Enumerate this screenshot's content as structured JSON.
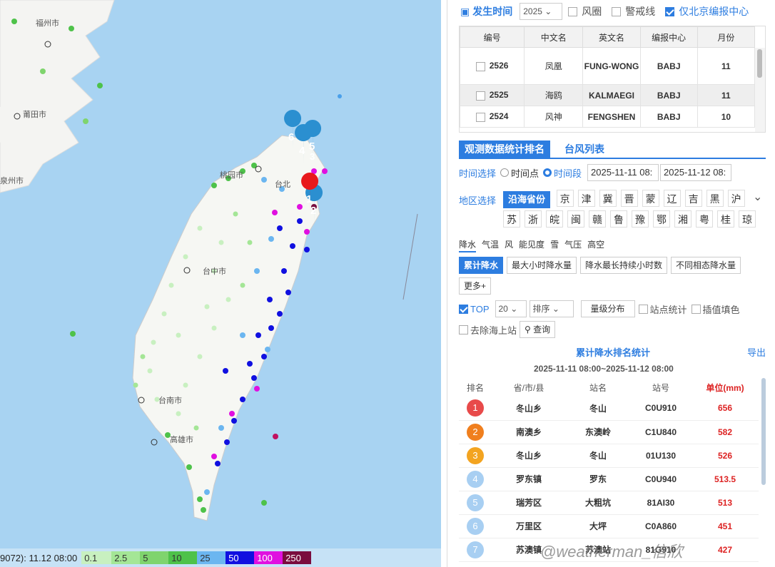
{
  "map": {
    "cities": [
      "福州市",
      "莆田市",
      "泉州市",
      "桃园市",
      "台北",
      "台中市",
      "台南市",
      "高雄市"
    ],
    "marker_labels": [
      "6",
      "4",
      "5",
      "1",
      "2",
      "3"
    ],
    "legend_title": "9072): 11.12 08:00",
    "legend": [
      {
        "label": "0.1",
        "color": "#c8f0c0"
      },
      {
        "label": "2.5",
        "color": "#a4e696"
      },
      {
        "label": "5",
        "color": "#7fd46e"
      },
      {
        "label": "10",
        "color": "#4ec24a"
      },
      {
        "label": "25",
        "color": "#6bb6f0"
      },
      {
        "label": "50",
        "color": "#1010e0"
      },
      {
        "label": "100",
        "color": "#e010e0"
      },
      {
        "label": "250",
        "color": "#7a0c3e"
      }
    ]
  },
  "header": {
    "time_label": "发生时间",
    "year": "2025",
    "fengquan": "风圈",
    "jingjiexian": "警戒线",
    "only_babj": "仅北京编报中心"
  },
  "typhoon_table": {
    "headers": [
      "编号",
      "中文名",
      "英文名",
      "编报中心",
      "月份"
    ],
    "rows": [
      {
        "id": "2526",
        "cn": "凤凰",
        "en": "FUNG-WONG",
        "center": "BABJ",
        "month": "11"
      },
      {
        "id": "2525",
        "cn": "海鸥",
        "en": "KALMAEGI",
        "center": "BABJ",
        "month": "11"
      },
      {
        "id": "2524",
        "cn": "风神",
        "en": "FENGSHEN",
        "center": "BABJ",
        "month": "10"
      }
    ]
  },
  "tabs": {
    "active": "观测数据统计排名",
    "other": "台风列表"
  },
  "time_select": {
    "label": "时间选择",
    "point": "时间点",
    "range": "时间段",
    "start": "2025-11-11 08:",
    "end": "2025-11-12 08:"
  },
  "region": {
    "label": "地区选择",
    "active": "沿海省份",
    "row1": [
      "京",
      "津",
      "冀",
      "晋",
      "蒙",
      "辽",
      "吉",
      "黑",
      "沪"
    ],
    "row2": [
      "苏",
      "浙",
      "皖",
      "闽",
      "赣",
      "鲁",
      "豫",
      "鄂",
      "湘",
      "粤",
      "桂",
      "琼"
    ]
  },
  "elements": [
    "降水",
    "气温",
    "风",
    "能见度",
    "雪",
    "气压",
    "高空"
  ],
  "precip_buttons": [
    "累计降水",
    "最大小时降水量",
    "降水最长持续小时数",
    "不同相态降水量"
  ],
  "more": "更多+",
  "options": {
    "top": "TOP",
    "top_n": "20",
    "sort": "排序",
    "grade": "量级分布",
    "station_stat": "站点统计",
    "interp": "插值填色",
    "remove_sea": "去除海上站",
    "query": "查询"
  },
  "ranking": {
    "title": "累计降水排名统计",
    "export": "导出",
    "period": "2025-11-11 08:00~2025-11-12 08:00",
    "headers": [
      "排名",
      "省/市/县",
      "站名",
      "站号",
      "单位(mm)"
    ],
    "rows": [
      {
        "rank": "1",
        "county": "冬山乡",
        "station": "冬山",
        "code": "C0U910",
        "value": "656",
        "color": "#e84a4a"
      },
      {
        "rank": "2",
        "county": "南澳乡",
        "station": "东澳岭",
        "code": "C1U840",
        "value": "582",
        "color": "#f07f1e"
      },
      {
        "rank": "3",
        "county": "冬山乡",
        "station": "冬山",
        "code": "01U130",
        "value": "526",
        "color": "#f3a420"
      },
      {
        "rank": "4",
        "county": "罗东镇",
        "station": "罗东",
        "code": "C0U940",
        "value": "513.5",
        "color": "#a8cff2"
      },
      {
        "rank": "5",
        "county": "瑞芳区",
        "station": "大粗坑",
        "code": "81AI30",
        "value": "513",
        "color": "#a8cff2"
      },
      {
        "rank": "6",
        "county": "万里区",
        "station": "大坪",
        "code": "C0A860",
        "value": "451",
        "color": "#a8cff2"
      },
      {
        "rank": "7",
        "county": "苏澳镇",
        "station": "苏澳站",
        "code": "81G910",
        "value": "427",
        "color": "#a8cff2"
      }
    ]
  },
  "watermark": "@weatherman_信欣",
  "colors": {
    "accent": "#2d7de0",
    "value_red": "#d22"
  }
}
